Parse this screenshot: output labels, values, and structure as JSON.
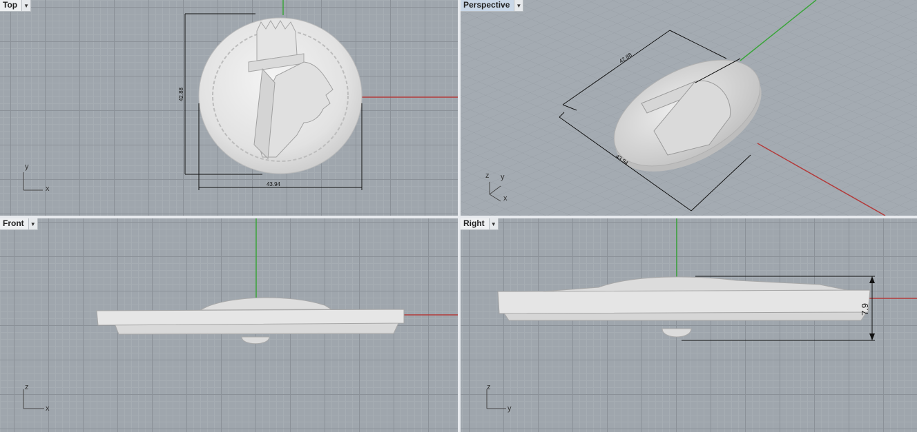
{
  "viewports": {
    "top": {
      "label": "Top",
      "axis_h": "x",
      "axis_v": "y",
      "dim_width": "43.94",
      "dim_height": "42.88"
    },
    "perspective": {
      "label": "Perspective",
      "axis_x": "x",
      "axis_y": "y",
      "axis_z": "z",
      "dim_width": "43.94",
      "dim_height": "42.88"
    },
    "front": {
      "label": "Front",
      "axis_h": "x",
      "axis_v": "z"
    },
    "right": {
      "label": "Right",
      "axis_h": "y",
      "axis_v": "z",
      "dim_height": "7.9"
    }
  },
  "colors": {
    "x_axis": "#b33a3a",
    "y_axis": "#3aa53a",
    "model": "#e9e9e9",
    "dimension": "#111111"
  }
}
